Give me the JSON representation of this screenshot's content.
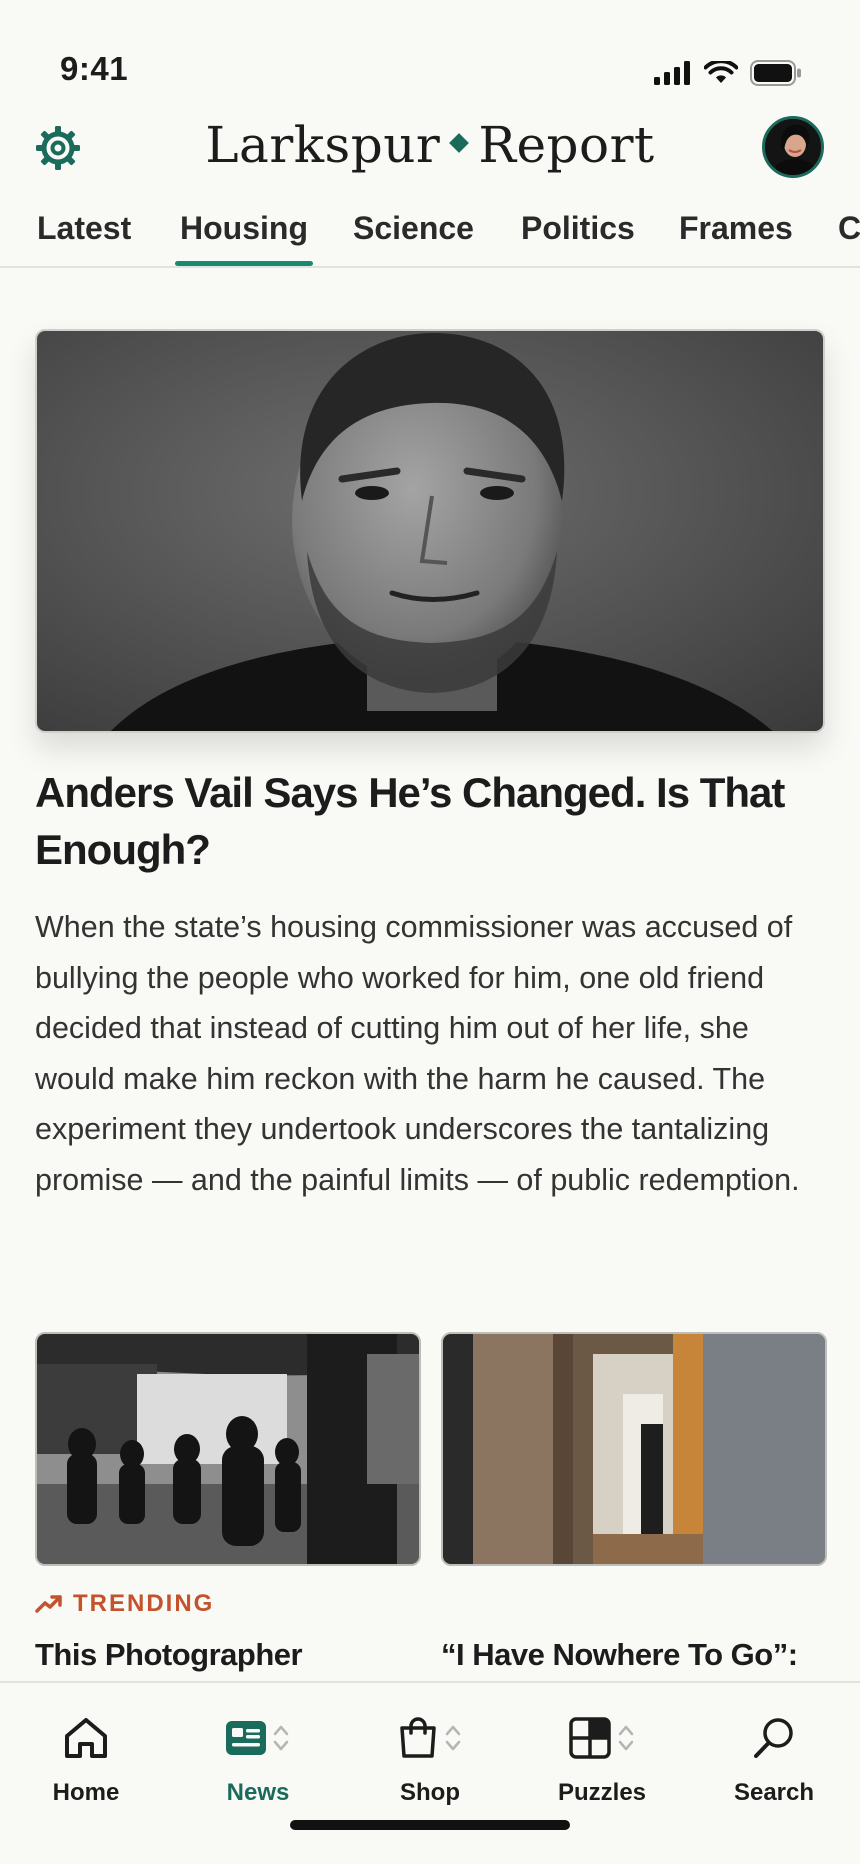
{
  "status_bar": {
    "time": "9:41"
  },
  "header": {
    "title_left": "Larkspur",
    "title_right": "Report"
  },
  "tabs": [
    {
      "label": "Latest",
      "active": false
    },
    {
      "label": "Housing",
      "active": true
    },
    {
      "label": "Science",
      "active": false
    },
    {
      "label": "Politics",
      "active": false
    },
    {
      "label": "Frames",
      "active": false
    },
    {
      "label": "C",
      "active": false
    }
  ],
  "hero": {
    "title": "Anders Vail Says He’s Changed. Is That Enough?",
    "summary": "When the state’s housing commissioner was accused of bullying the people who worked for him, one old friend decided that instead of cutting him out of her life, she would make him reckon with the harm he caused. The experiment they undertook underscores the tantalizing promise — and the painful limits — of public redemption."
  },
  "cards": [
    {
      "kicker": "TRENDING",
      "title": "This Photographer"
    },
    {
      "kicker": "",
      "title": "“I Have Nowhere To Go”: This Woman Lost Her Everyth..."
    }
  ],
  "bottom_nav": [
    {
      "label": "Home",
      "icon": "house-icon",
      "active": false
    },
    {
      "label": "News",
      "icon": "newspaper-icon",
      "active": true
    },
    {
      "label": "Shop",
      "icon": "shopping-bag-icon",
      "active": false
    },
    {
      "label": "Puzzles",
      "icon": "grid-icon",
      "active": false
    },
    {
      "label": "Search",
      "icon": "search-icon",
      "active": false
    }
  ],
  "colors": {
    "accent": "#1a6b5c",
    "trending": "#c2532c",
    "background": "#f9f9f6"
  }
}
